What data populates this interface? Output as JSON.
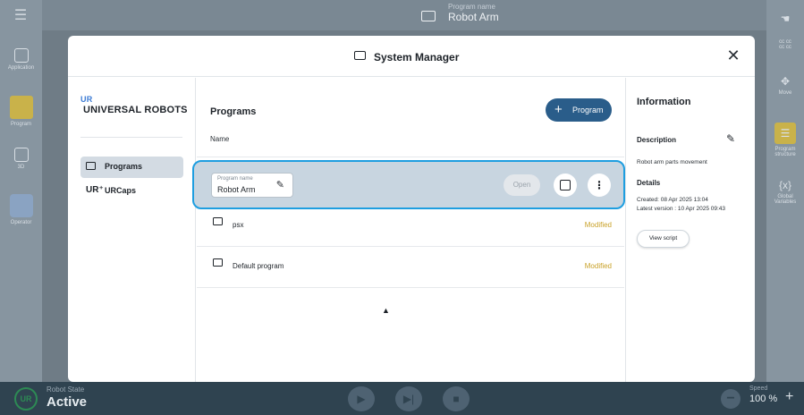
{
  "header": {
    "program_name_label": "Program name",
    "program_name": "Robot Arm"
  },
  "left_rail": {
    "items": [
      {
        "label": "Application",
        "icon": "grid-icon"
      },
      {
        "label": "Program",
        "icon": "program-icon"
      },
      {
        "label": "3D",
        "icon": "cube-icon"
      },
      {
        "label": "Operator",
        "icon": "user-icon"
      }
    ]
  },
  "right_rail": {
    "items": [
      {
        "label": "",
        "icon": "hand-icon"
      },
      {
        "label": "cc cc\ncc cc",
        "icon": "text"
      },
      {
        "label": "Move",
        "icon": "move-icon"
      },
      {
        "label": "Program structure",
        "icon": "list-icon"
      },
      {
        "label": "Global Variables",
        "icon": "variables-icon"
      }
    ]
  },
  "bottom_bar": {
    "robot_state_label": "Robot State",
    "robot_state": "Active",
    "speed_label": "Speed",
    "speed_value": "100 %"
  },
  "modal": {
    "title": "System Manager",
    "logo_text": "UNIVERSAL ROBOTS",
    "nav": [
      {
        "label": "Programs",
        "active": true
      },
      {
        "label": "URCaps",
        "active": false
      }
    ],
    "main_title": "Programs",
    "add_button": "Program",
    "column_name": "Name",
    "selected_program": {
      "field_label": "Program name",
      "value": "Robot Arm",
      "open_label": "Open"
    },
    "programs": [
      {
        "name": "psx",
        "status": "Modified"
      },
      {
        "name": "Default program",
        "status": "Modified"
      }
    ],
    "info": {
      "title": "Information",
      "description_label": "Description",
      "description": "Robot arm parts movement",
      "details_label": "Details",
      "created": "Created: 08 Apr 2025 13:04",
      "latest_version": "Latest version : 10 Apr 2025 09:43",
      "view_script": "View script"
    }
  },
  "colors": {
    "accent": "#1e9ee0",
    "primary_button": "#2a5d8a",
    "modified_status": "#c9a22a",
    "bottom_bar": "#2f4350"
  }
}
